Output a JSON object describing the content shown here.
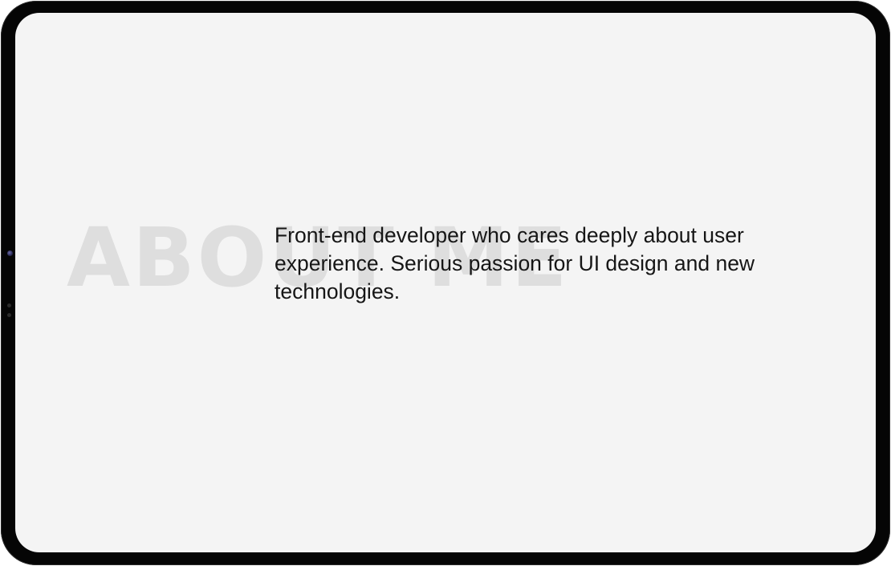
{
  "about": {
    "background_heading": "ABOUT ME",
    "description": "Front-end developer who cares deeply about user experience. Serious passion for UI design and new technologies."
  },
  "theme": {
    "screen_background": "#f4f4f4",
    "heading_color": "#dedede",
    "text_color": "#161616",
    "bezel_color": "#050505"
  }
}
